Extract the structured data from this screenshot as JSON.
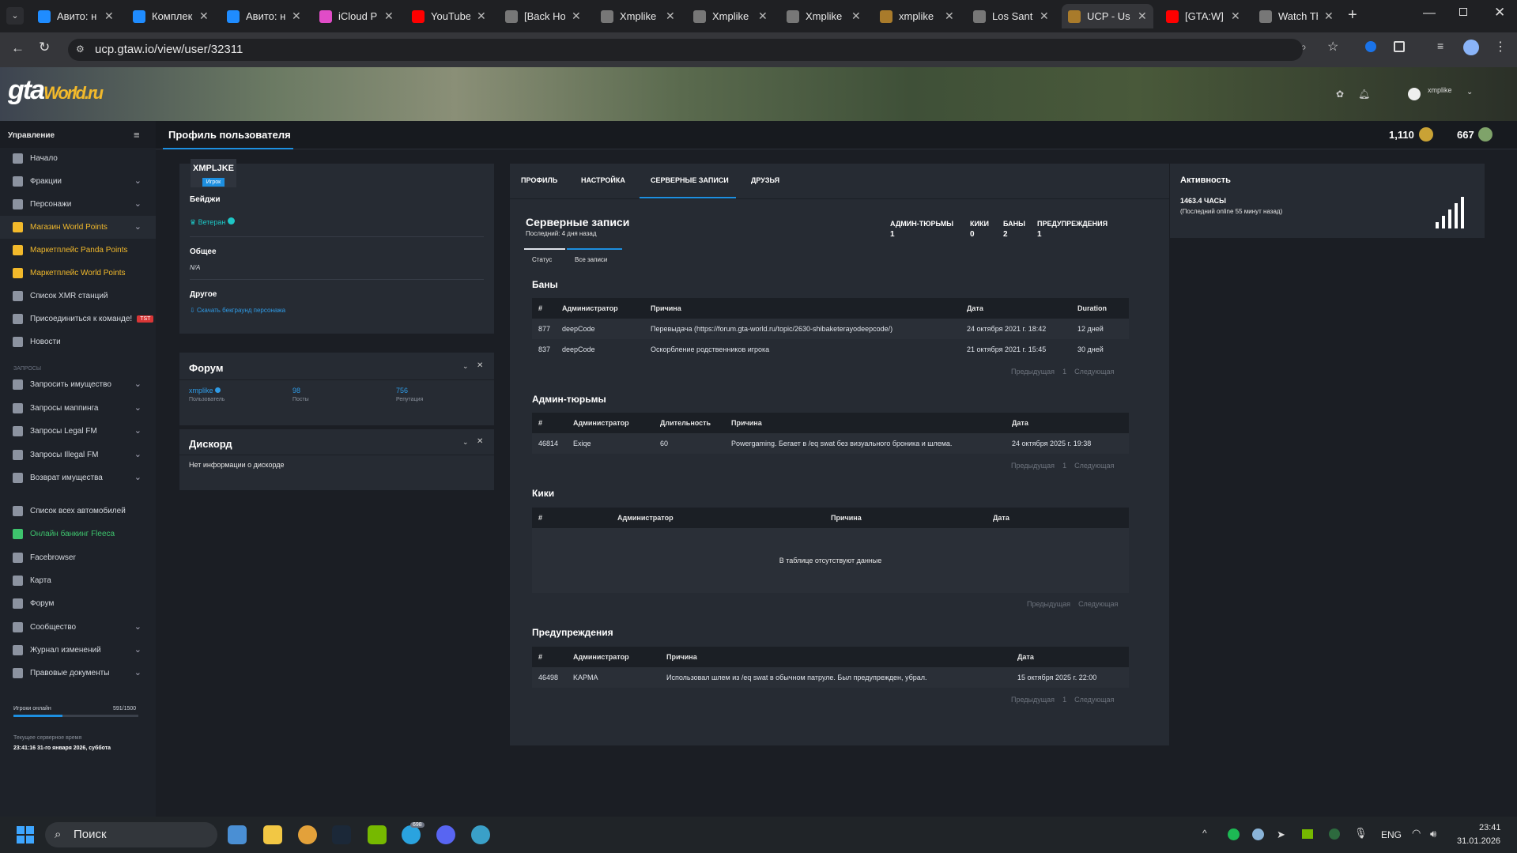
{
  "browser": {
    "tabs": [
      {
        "label": "Авито: н",
        "color": "#1f8cff"
      },
      {
        "label": "Комплек",
        "color": "#1f8cff"
      },
      {
        "label": "Авито: н",
        "color": "#1f8cff"
      },
      {
        "label": "iCloud Pl",
        "color": "#e04cc7"
      },
      {
        "label": "YouTube",
        "color": "#ff0000"
      },
      {
        "label": "[Back Ho",
        "color": "#777"
      },
      {
        "label": "Xmplike",
        "color": "#777"
      },
      {
        "label": "Xmplike",
        "color": "#777"
      },
      {
        "label": "Xmplike",
        "color": "#777"
      },
      {
        "label": "xmplike",
        "color": "#a97b2b"
      },
      {
        "label": "Los Sant",
        "color": "#777"
      },
      {
        "label": "UCP - Us",
        "color": "#a97b2b"
      },
      {
        "label": "[GTA:W]",
        "color": "#ff0000"
      },
      {
        "label": "Watch Th",
        "color": "#777"
      }
    ],
    "url": "ucp.gtaw.io/view/user/32311"
  },
  "header": {
    "logo": "gta",
    "logo_sub": "World.ru",
    "username": "xmplike"
  },
  "sidebar": {
    "title": "Управление",
    "items": [
      {
        "label": "Начало"
      },
      {
        "label": "Фракции",
        "chevron": true
      },
      {
        "label": "Персонажи",
        "chevron": true
      },
      {
        "label": "Магазин World Points",
        "chevron": true,
        "style": "yel"
      },
      {
        "label": "Маркетплейс Panda Points",
        "style": "yel"
      },
      {
        "label": "Маркетплейс World Points",
        "style": "yel"
      },
      {
        "label": "Список XMR станций"
      },
      {
        "label": "Присоединиться к команде!",
        "badge": "TST"
      },
      {
        "label": "Новости"
      }
    ],
    "section2": "ЗАПРОСЫ",
    "items2": [
      {
        "label": "Запросить имущество",
        "chevron": true
      },
      {
        "label": "Запросы маппинга",
        "chevron": true
      },
      {
        "label": "Запросы Legal FM",
        "chevron": true
      },
      {
        "label": "Запросы Illegal FM",
        "chevron": true
      },
      {
        "label": "Возврат имущества",
        "chevron": true
      }
    ],
    "items3": [
      {
        "label": "Список всех автомобилей"
      },
      {
        "label": "Онлайн банкинг Fleeca",
        "style": "grn"
      },
      {
        "label": "Facebrowser"
      },
      {
        "label": "Карта"
      },
      {
        "label": "Форум"
      },
      {
        "label": "Сообщество",
        "chevron": true
      },
      {
        "label": "Журнал изменений",
        "chevron": true
      },
      {
        "label": "Правовые документы",
        "chevron": true
      }
    ],
    "players_label": "Игроки онлайн",
    "players_value": "591/1500",
    "players_fraction": 0.394,
    "time_label": "Текущее серверное время",
    "time_value": "23:41:16 31-го января 2026, суббота"
  },
  "page": {
    "title": "Профиль пользователя",
    "points1": "1,110",
    "points2": "667"
  },
  "profile": {
    "name": "XMPLJKE",
    "role": "Игрок",
    "badges_label": "Бейджи",
    "badge": "Ветеран",
    "general_label": "Общее",
    "general_value": "N/A",
    "other_label": "Другое",
    "other_link": "Скачать бекграунд персонажа"
  },
  "forum": {
    "title": "Форум",
    "user": "xmplike",
    "user_label": "Пользователь",
    "posts": "98",
    "posts_label": "Посты",
    "rep": "756",
    "rep_label": "Репутация"
  },
  "discord": {
    "title": "Дискорд",
    "text": "Нет информации о дискорде"
  },
  "tabs": [
    "ПРОФИЛЬ",
    "НАСТРОЙКА",
    "СЕРВЕРНЫЕ ЗАПИСИ",
    "ДРУЗЬЯ"
  ],
  "records": {
    "title": "Серверные записи",
    "subtitle": "Последний: 4 дня назад",
    "stats": [
      {
        "label": "АДМИН-ТЮРЬМЫ",
        "value": "1"
      },
      {
        "label": "КИКИ",
        "value": "0"
      },
      {
        "label": "БАНЫ",
        "value": "2"
      },
      {
        "label": "ПРЕДУПРЕЖДЕНИЯ",
        "value": "1"
      }
    ],
    "subtabs": [
      "Статус",
      "Все записи"
    ],
    "prev": "Предыдущая",
    "next": "Следующая",
    "page": "1",
    "bans": {
      "title": "Баны",
      "headers": [
        "#",
        "Администратор",
        "Причина",
        "Дата",
        "Duration"
      ],
      "rows": [
        [
          "877",
          "deepCode",
          "Перевыдача (https://forum.gta-world.ru/topic/2630-shibaketerayodeepcode/)",
          "24 октября 2021 г. 18:42",
          "12 дней"
        ],
        [
          "837",
          "deepCode",
          "Оскорбление родственников игрока",
          "21 октября 2021 г. 15:45",
          "30 дней"
        ]
      ]
    },
    "jail": {
      "title": "Админ-тюрьмы",
      "headers": [
        "#",
        "Администратор",
        "Длительность",
        "Причина",
        "Дата"
      ],
      "rows": [
        [
          "46814",
          "Exiqe",
          "60",
          "Powergaming. Бегает в /eq swat без визуального броника и шлема.",
          "24 октября 2025 г. 19:38"
        ]
      ]
    },
    "kicks": {
      "title": "Кики",
      "headers": [
        "#",
        "Администратор",
        "Причина",
        "Дата"
      ],
      "empty": "В таблице отсутствуют данные"
    },
    "warns": {
      "title": "Предупреждения",
      "headers": [
        "#",
        "Администратор",
        "Причина",
        "Дата"
      ],
      "rows": [
        [
          "46498",
          "KAPMA",
          "Использовал шлем из /eq swat в обычном патруле. Был предупрежден, убрал.",
          "15 октября 2025 г. 22:00"
        ]
      ]
    }
  },
  "activity": {
    "title": "Активность",
    "hours": "1463.4 ЧАСЫ",
    "last": "(Последний online 55 минут назад)"
  },
  "taskbar": {
    "search": "Поиск",
    "lang": "ENG",
    "time": "23:41",
    "date": "31.01.2026",
    "telegram_badge": "698"
  }
}
